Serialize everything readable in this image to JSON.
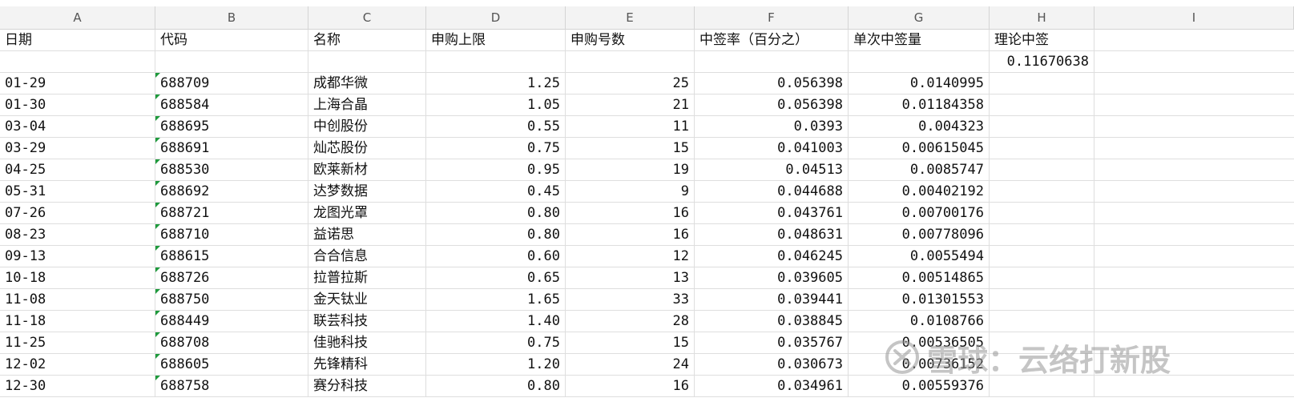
{
  "columns": [
    "A",
    "B",
    "C",
    "D",
    "E",
    "F",
    "G",
    "H",
    "I"
  ],
  "header": {
    "date": "日期",
    "code": "代码",
    "name": "名称",
    "limit": "申购上限",
    "count": "申购号数",
    "rate": "中签率（百分之）",
    "single": "单次中签量",
    "theory": "理论中签"
  },
  "theory_value": "0.11670638",
  "rows": [
    {
      "date": "01-29",
      "code": "688709",
      "name": "成都华微",
      "limit": "1.25",
      "count": "25",
      "rate": "0.056398",
      "single": "0.0140995"
    },
    {
      "date": "01-30",
      "code": "688584",
      "name": "上海合晶",
      "limit": "1.05",
      "count": "21",
      "rate": "0.056398",
      "single": "0.01184358"
    },
    {
      "date": "03-04",
      "code": "688695",
      "name": "中创股份",
      "limit": "0.55",
      "count": "11",
      "rate": "0.0393",
      "single": "0.004323"
    },
    {
      "date": "03-29",
      "code": "688691",
      "name": "灿芯股份",
      "limit": "0.75",
      "count": "15",
      "rate": "0.041003",
      "single": "0.00615045"
    },
    {
      "date": "04-25",
      "code": "688530",
      "name": "欧莱新材",
      "limit": "0.95",
      "count": "19",
      "rate": "0.04513",
      "single": "0.0085747"
    },
    {
      "date": "05-31",
      "code": "688692",
      "name": "达梦数据",
      "limit": "0.45",
      "count": "9",
      "rate": "0.044688",
      "single": "0.00402192"
    },
    {
      "date": "07-26",
      "code": "688721",
      "name": "龙图光罩",
      "limit": "0.80",
      "count": "16",
      "rate": "0.043761",
      "single": "0.00700176"
    },
    {
      "date": "08-23",
      "code": "688710",
      "name": "益诺思",
      "limit": "0.80",
      "count": "16",
      "rate": "0.048631",
      "single": "0.00778096"
    },
    {
      "date": "09-13",
      "code": "688615",
      "name": "合合信息",
      "limit": "0.60",
      "count": "12",
      "rate": "0.046245",
      "single": "0.0055494"
    },
    {
      "date": "10-18",
      "code": "688726",
      "name": "拉普拉斯",
      "limit": "0.65",
      "count": "13",
      "rate": "0.039605",
      "single": "0.00514865"
    },
    {
      "date": "11-08",
      "code": "688750",
      "name": "金天钛业",
      "limit": "1.65",
      "count": "33",
      "rate": "0.039441",
      "single": "0.01301553"
    },
    {
      "date": "11-18",
      "code": "688449",
      "name": "联芸科技",
      "limit": "1.40",
      "count": "28",
      "rate": "0.038845",
      "single": "0.0108766"
    },
    {
      "date": "11-25",
      "code": "688708",
      "name": "佳驰科技",
      "limit": "0.75",
      "count": "15",
      "rate": "0.035767",
      "single": "0.00536505"
    },
    {
      "date": "12-02",
      "code": "688605",
      "name": "先锋精科",
      "limit": "1.20",
      "count": "24",
      "rate": "0.030673",
      "single": "0.00736152"
    },
    {
      "date": "12-30",
      "code": "688758",
      "name": "赛分科技",
      "limit": "0.80",
      "count": "16",
      "rate": "0.034961",
      "single": "0.00559376"
    }
  ],
  "watermark": {
    "text": "雪球：云络打新股",
    "icon": "snowball-logo-icon",
    "color": "#969696"
  },
  "colors": {
    "header_bg": "#f3f3f3",
    "gridline": "#dedede",
    "text_marker": "#1e9a3c"
  }
}
